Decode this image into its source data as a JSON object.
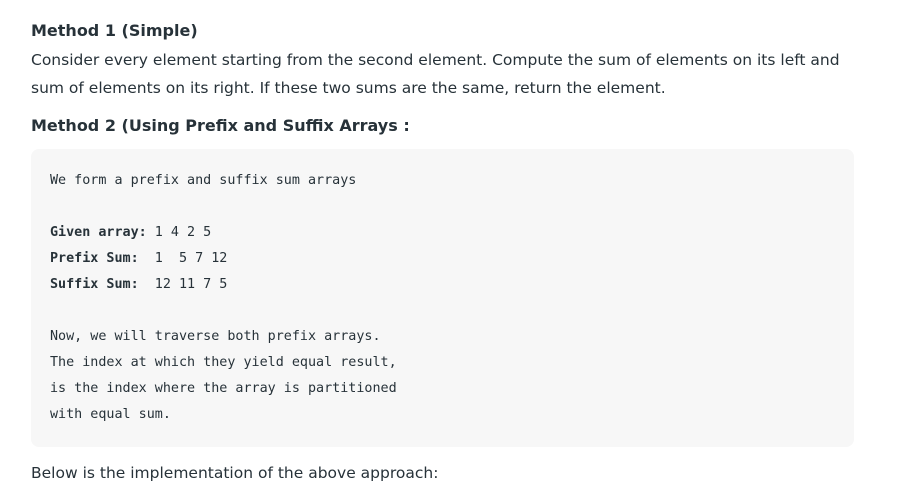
{
  "method1": {
    "heading": "Method 1 (Simple)",
    "description": "Consider every element starting from the second element. Compute the sum of elements on its left and sum of elements on its right. If these two sums are the same, return the element."
  },
  "method2": {
    "heading": "Method 2 (Using Prefix and Suffix Arrays :",
    "code": {
      "intro": "We form a prefix and suffix sum arrays",
      "given_label": "Given array:",
      "given_value": " 1 4 2 5",
      "prefix_label": "Prefix Sum:",
      "prefix_value": "  1  5 7 12",
      "suffix_label": "Suffix Sum:",
      "suffix_value": "  12 11 7 5",
      "explain_1": "Now, we will traverse both prefix arrays.",
      "explain_2": "The index at which they yield equal result,",
      "explain_3": "is the index where the array is partitioned",
      "explain_4": "with equal sum."
    }
  },
  "closing": "Below is the implementation of the above approach:"
}
